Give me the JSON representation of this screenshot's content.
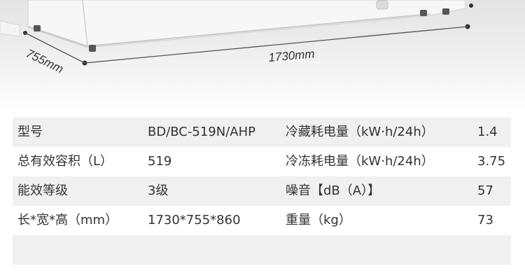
{
  "dimensions": {
    "width_label": "1730mm",
    "depth_label": "755mm"
  },
  "specs": {
    "rows": [
      {
        "label1": "型号",
        "value1": "BD/BC-519N/AHP",
        "label2": "冷藏耗电量（kW·h/24h）",
        "value2": "1.4"
      },
      {
        "label1": "总有效容积（L）",
        "value1": "519",
        "label2": "冷冻耗电量（kW·h/24h）",
        "value2": "3.75"
      },
      {
        "label1": "能效等级",
        "value1": "3级",
        "label2": "噪音【dB（A）】",
        "value2": "57"
      },
      {
        "label1": "长*宽*高（mm）",
        "value1": "1730*755*860",
        "label2": "重量（kg）",
        "value2": "73"
      }
    ]
  }
}
